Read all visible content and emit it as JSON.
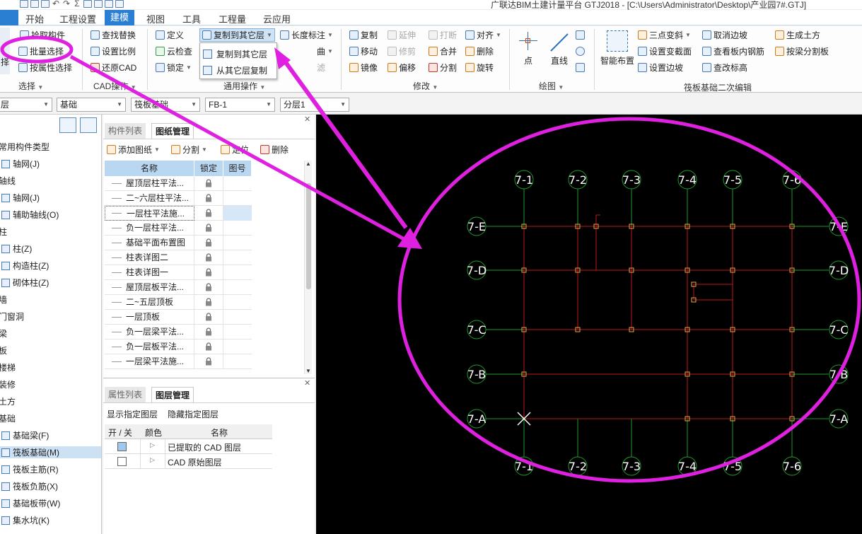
{
  "window": {
    "title": "广联达BIM土建计量平台 GTJ2018 - [C:\\Users\\Administrator\\Desktop\\产业园7#.GTJ]"
  },
  "menu_tabs": [
    "开始",
    "工程设置",
    "建模",
    "视图",
    "工具",
    "工程量",
    "云应用"
  ],
  "active_tab": "建模",
  "ribbon": {
    "select": {
      "pick": "拾取构件",
      "batch": "批量选择",
      "by_attr": "按属性选择",
      "big_cut": "择",
      "label": "选择"
    },
    "cad": {
      "find_replace": "查找替换",
      "set_scale": "设置比例",
      "restore_cad": "还原CAD",
      "label": "CAD操作"
    },
    "common": {
      "define": "定义",
      "cloud_check": "云检查",
      "lock": "锁定",
      "copy_to_other": "复制到其它层",
      "length_mark": "长度标注",
      "curve_cut": "曲",
      "filter_cut": "滤",
      "label": "通用操作"
    },
    "dropdown": {
      "copy_to_other": "复制到其它层",
      "copy_from_other": "从其它层复制"
    },
    "modify": {
      "copy": "复制",
      "extend": "延伸",
      "break": "打断",
      "align": "对齐",
      "move": "移动",
      "trim": "修剪",
      "merge": "合并",
      "delete": "删除",
      "mirror": "镜像",
      "offset": "偏移",
      "split": "分割",
      "rotate": "旋转",
      "label": "修改"
    },
    "draw": {
      "point": "点",
      "line": "直线",
      "label": "绘图"
    },
    "raft_edit": {
      "smart_place": "智能布置",
      "three_point_slope": "三点变斜",
      "set_variable_section": "设置变截面",
      "set_side_slope": "设置边坡",
      "cancel_side_slope": "取消边坡",
      "view_rebar": "查看板内钢筋",
      "modify_elevation": "查改标高",
      "gen_earthwork": "生成土方",
      "split_by_beam": "按梁分割板",
      "label": "筏板基础二次编辑"
    }
  },
  "filters": {
    "floor": "层",
    "category": "基础",
    "type": "筏板基础",
    "component": "FB-1",
    "sublayer": "分层1"
  },
  "tree": [
    {
      "label": "常用构件类型",
      "icon": false,
      "indent": 0
    },
    {
      "label": "轴网(J)",
      "icon": true,
      "indent": 1
    },
    {
      "label": "轴线",
      "icon": false,
      "indent": 0
    },
    {
      "label": "轴网(J)",
      "icon": true,
      "indent": 1
    },
    {
      "label": "辅助轴线(O)",
      "icon": true,
      "indent": 1
    },
    {
      "label": "柱",
      "icon": false,
      "indent": 0
    },
    {
      "label": "柱(Z)",
      "icon": true,
      "indent": 1
    },
    {
      "label": "构造柱(Z)",
      "icon": true,
      "indent": 1
    },
    {
      "label": "砌体柱(Z)",
      "icon": true,
      "indent": 1
    },
    {
      "label": "墙",
      "icon": false,
      "indent": 0
    },
    {
      "label": "门窗洞",
      "icon": false,
      "indent": 0
    },
    {
      "label": "梁",
      "icon": false,
      "indent": 0
    },
    {
      "label": "板",
      "icon": false,
      "indent": 0
    },
    {
      "label": "楼梯",
      "icon": false,
      "indent": 0
    },
    {
      "label": "装修",
      "icon": false,
      "indent": 0
    },
    {
      "label": "土方",
      "icon": false,
      "indent": 0
    },
    {
      "label": "基础",
      "icon": false,
      "indent": 0
    },
    {
      "label": "基础梁(F)",
      "icon": true,
      "indent": 1
    },
    {
      "label": "筏板基础(M)",
      "icon": true,
      "indent": 1,
      "selected": true
    },
    {
      "label": "筏板主筋(R)",
      "icon": true,
      "indent": 1
    },
    {
      "label": "筏板负筋(X)",
      "icon": true,
      "indent": 1
    },
    {
      "label": "基础板带(W)",
      "icon": true,
      "indent": 1
    },
    {
      "label": "集水坑(K)",
      "icon": true,
      "indent": 1
    }
  ],
  "mid_panel": {
    "tabs": [
      "构件列表",
      "图纸管理"
    ],
    "active_tab": "图纸管理",
    "toolbar": {
      "add": "添加图纸",
      "split": "分割",
      "locate": "定位",
      "delete": "删除"
    },
    "columns": [
      "名称",
      "锁定",
      "图号"
    ],
    "rows": [
      "屋顶层柱平法...",
      "二~六层柱平法...",
      "一层柱平法施...",
      "负一层柱平法...",
      "基础平面布置图",
      "柱表详图二",
      "柱表详图一",
      "屋顶层板平法...",
      "二~五层顶板",
      "一层顶板",
      "负一层梁平法...",
      "负一层板平法...",
      "一层梁平法施..."
    ],
    "highlight_row": 2
  },
  "layer_panel": {
    "tabs": [
      "属性列表",
      "图层管理"
    ],
    "active_tab": "图层管理",
    "show_specified": "显示指定图层",
    "hide_specified": "隐藏指定图层",
    "columns": [
      "开 / 关",
      "颜色",
      "名称"
    ],
    "rows": [
      {
        "name": "已提取的 CAD 图层",
        "on": true
      },
      {
        "name": "CAD 原始图层",
        "on": false
      }
    ]
  },
  "cad": {
    "top_axes": [
      "7-1",
      "7-2",
      "7-3",
      "7-4",
      "7-5",
      "7-6"
    ],
    "bottom_axes": [
      "7-1",
      "7-2",
      "7-3",
      "7-4",
      "7-5",
      "7-6"
    ],
    "left_axes": [
      "7-E",
      "7-D",
      "7-C",
      "7-B",
      "7-A"
    ],
    "right_axes": [
      "7-E",
      "7-D",
      "7-C",
      "7-B",
      "7-A"
    ]
  },
  "colors": {
    "accent": "#2b7fd3",
    "annotation": "#e020e0",
    "grid_red": "#c01818",
    "grid_green": "#1f9a2a",
    "node": "#e8a64a"
  }
}
